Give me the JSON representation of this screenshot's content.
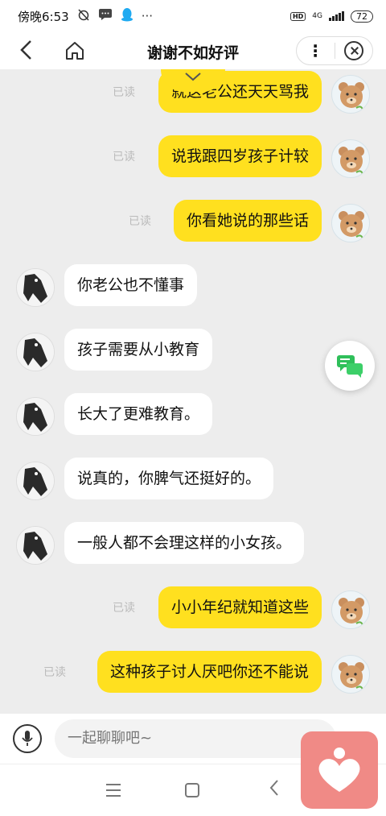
{
  "status_bar": {
    "time": "傍晚6:53",
    "hd_label": "HD",
    "network": "4G",
    "battery": "72"
  },
  "header": {
    "title": "谢谢不如好评"
  },
  "messages": [
    {
      "side": "me",
      "text": "就这老公还天天骂我",
      "read": "已读"
    },
    {
      "side": "me",
      "text": "说我跟四岁孩子计较",
      "read": "已读"
    },
    {
      "side": "me",
      "text": "你看她说的那些话",
      "read": "已读"
    },
    {
      "side": "them",
      "text": "你老公也不懂事"
    },
    {
      "side": "them",
      "text": "孩子需要从小教育"
    },
    {
      "side": "them",
      "text": "长大了更难教育。"
    },
    {
      "side": "them",
      "text": "说真的，你脾气还挺好的。"
    },
    {
      "side": "them",
      "text": "一般人都不会理这样的小女孩。"
    },
    {
      "side": "me",
      "text": "小小年纪就知道这些",
      "read": "已读"
    },
    {
      "side": "me",
      "text": "这种孩子讨人厌吧你还不能说",
      "read": "已读"
    }
  ],
  "input": {
    "placeholder": "一起聊聊吧~"
  },
  "colors": {
    "my_bubble": "#ffe01f",
    "their_bubble": "#ffffff",
    "background": "#ededed",
    "float_icon": "#2fbf5a",
    "heart_app": "#f08a86"
  }
}
